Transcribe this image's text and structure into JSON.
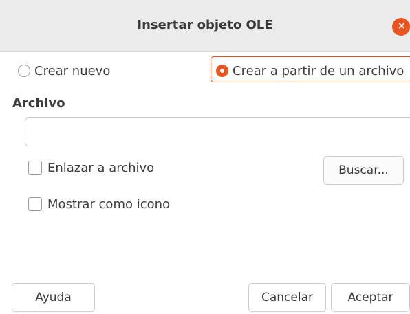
{
  "window": {
    "title": "Insertar objeto OLE",
    "close_icon": "close-icon",
    "close_glyph": "×"
  },
  "options": {
    "create_new_label": "Crear nuevo",
    "create_from_file_label": "Crear a partir de un archivo",
    "selected": "create_from_file"
  },
  "file": {
    "section_label": "Archivo",
    "path_value": "",
    "browse_label": "Buscar..."
  },
  "checkboxes": {
    "link_to_file_label": "Enlazar a archivo",
    "link_to_file_checked": false,
    "display_as_icon_label": "Mostrar como icono",
    "display_as_icon_checked": false
  },
  "footer": {
    "help_label": "Ayuda",
    "cancel_label": "Cancelar",
    "ok_label": "Aceptar"
  },
  "colors": {
    "accent": "#e95420",
    "titlebar_bg": "#ebebeb",
    "border": "#cdcdcd"
  }
}
